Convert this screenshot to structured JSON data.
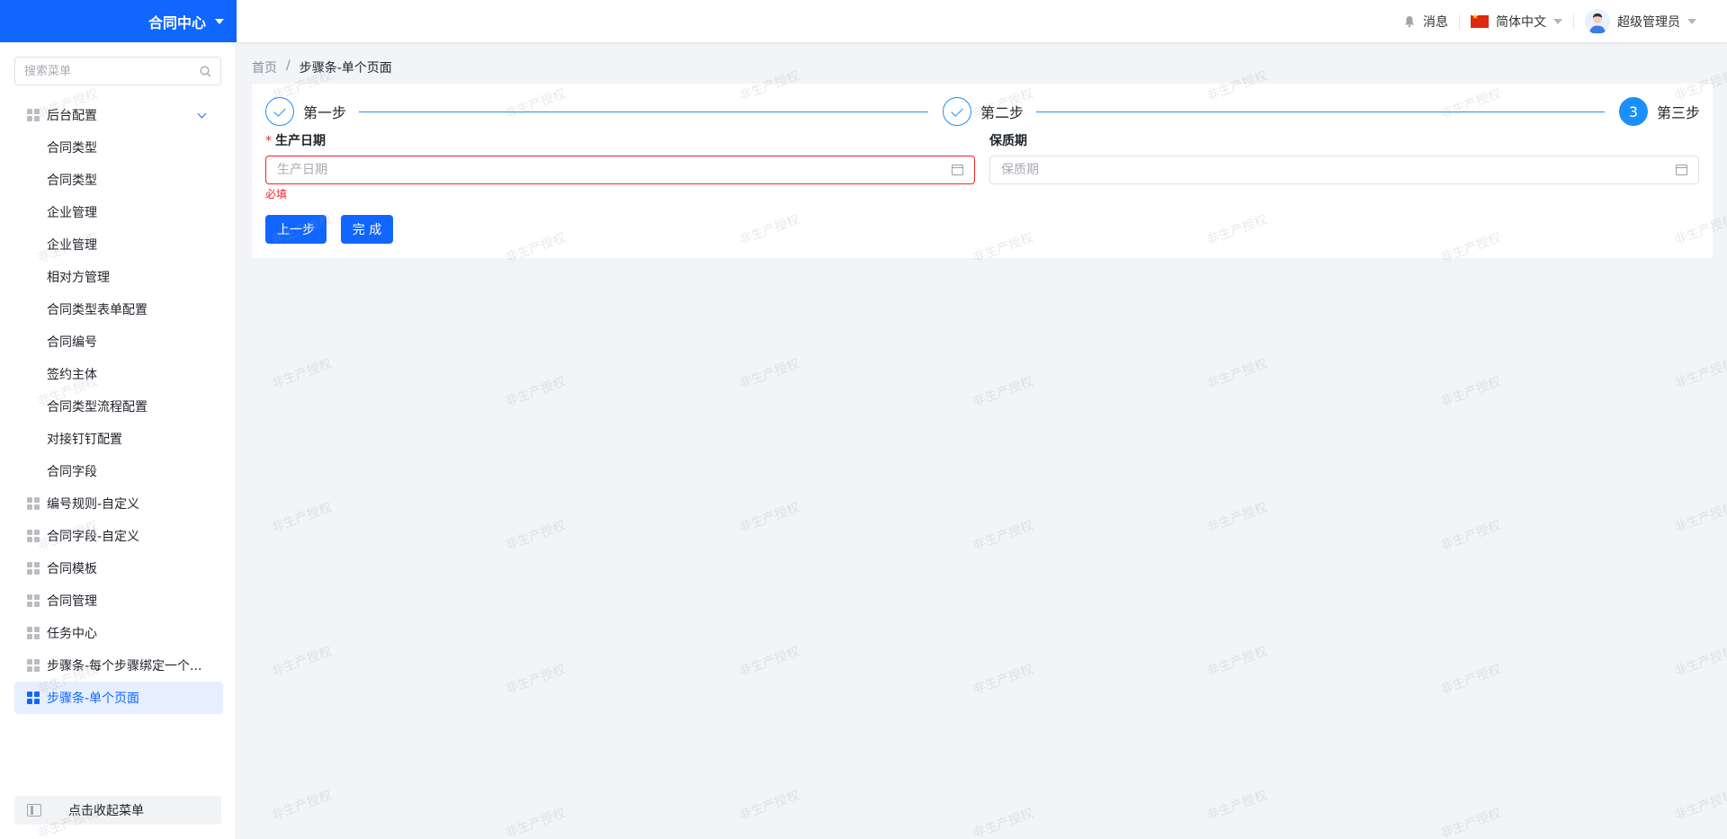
{
  "brand": {
    "title": "合同中心"
  },
  "topbar": {
    "messages_label": "消息",
    "language_label": "简体中文",
    "user_name": "超级管理员"
  },
  "sidebar": {
    "search_placeholder": "搜索菜单",
    "items": [
      {
        "label": "后台配置",
        "level": 1,
        "expanded": true
      },
      {
        "label": "合同类型",
        "level": 2
      },
      {
        "label": "合同类型",
        "level": 2
      },
      {
        "label": "企业管理",
        "level": 2
      },
      {
        "label": "企业管理",
        "level": 2
      },
      {
        "label": "相对方管理",
        "level": 2
      },
      {
        "label": "合同类型表单配置",
        "level": 2
      },
      {
        "label": "合同编号",
        "level": 2
      },
      {
        "label": "签约主体",
        "level": 2
      },
      {
        "label": "合同类型流程配置",
        "level": 2
      },
      {
        "label": "对接钉钉配置",
        "level": 2
      },
      {
        "label": "合同字段",
        "level": 2
      },
      {
        "label": "编号规则-自定义",
        "level": 1
      },
      {
        "label": "合同字段-自定义",
        "level": 1
      },
      {
        "label": "合同模板",
        "level": 1
      },
      {
        "label": "合同管理",
        "level": 1
      },
      {
        "label": "任务中心",
        "level": 1
      },
      {
        "label": "步骤条-每个步骤绑定一个...",
        "level": 1
      },
      {
        "label": "步骤条-单个页面",
        "level": 1,
        "active": true
      }
    ],
    "collapse_label": "点击收起菜单"
  },
  "breadcrumb": {
    "home": "首页",
    "separator": "/",
    "current": "步骤条-单个页面"
  },
  "steps": [
    {
      "title": "第一步",
      "status": "finished"
    },
    {
      "title": "第二步",
      "status": "finished"
    },
    {
      "title": "第三步",
      "status": "current",
      "number": "3"
    }
  ],
  "form": {
    "production_date": {
      "label": "生产日期",
      "required_mark": "*",
      "placeholder": "生产日期",
      "value": "",
      "error": "必填"
    },
    "shelf_life": {
      "label": "保质期",
      "placeholder": "保质期",
      "value": ""
    }
  },
  "buttons": {
    "prev": "上一步",
    "finish": "完 成"
  },
  "watermark": "非生产授权",
  "colors": {
    "brand": "#1166ff",
    "step": "#1c8fff",
    "error": "#f5222d",
    "active_menu_bg": "#e6efff"
  }
}
